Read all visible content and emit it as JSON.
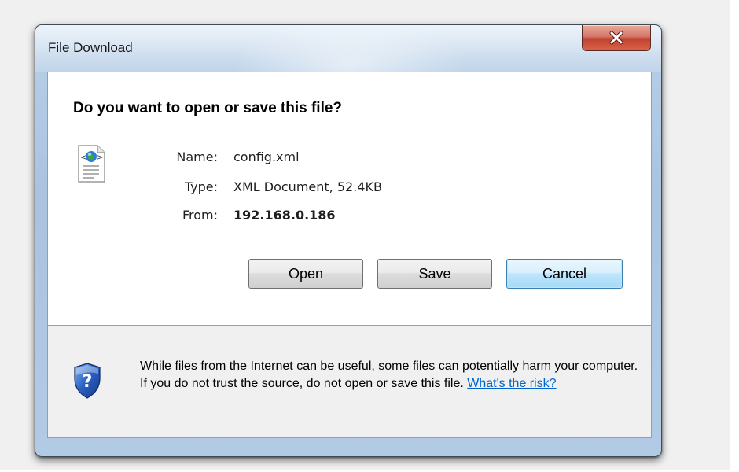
{
  "window": {
    "title": "File Download"
  },
  "dialog": {
    "prompt": "Do you want to open or save this file?",
    "file_info": {
      "name_label": "Name:",
      "name_value": "config.xml",
      "type_label": "Type:",
      "type_value": "XML Document, 52.4KB",
      "from_label": "From:",
      "from_value": "192.168.0.186"
    },
    "buttons": {
      "open": "Open",
      "save": "Save",
      "cancel": "Cancel"
    },
    "warning": {
      "text": "While files from the Internet can be useful, some files can potentially harm your computer. If you do not trust the source, do not open or save this file.",
      "link": "What's the risk?"
    }
  },
  "icons": {
    "close": "close-icon",
    "file": "xml-file-icon",
    "shield": "shield-question-icon"
  },
  "colors": {
    "close_button": "#c2412f",
    "link": "#0066cc",
    "default_button_border": "#3c7fb1"
  }
}
